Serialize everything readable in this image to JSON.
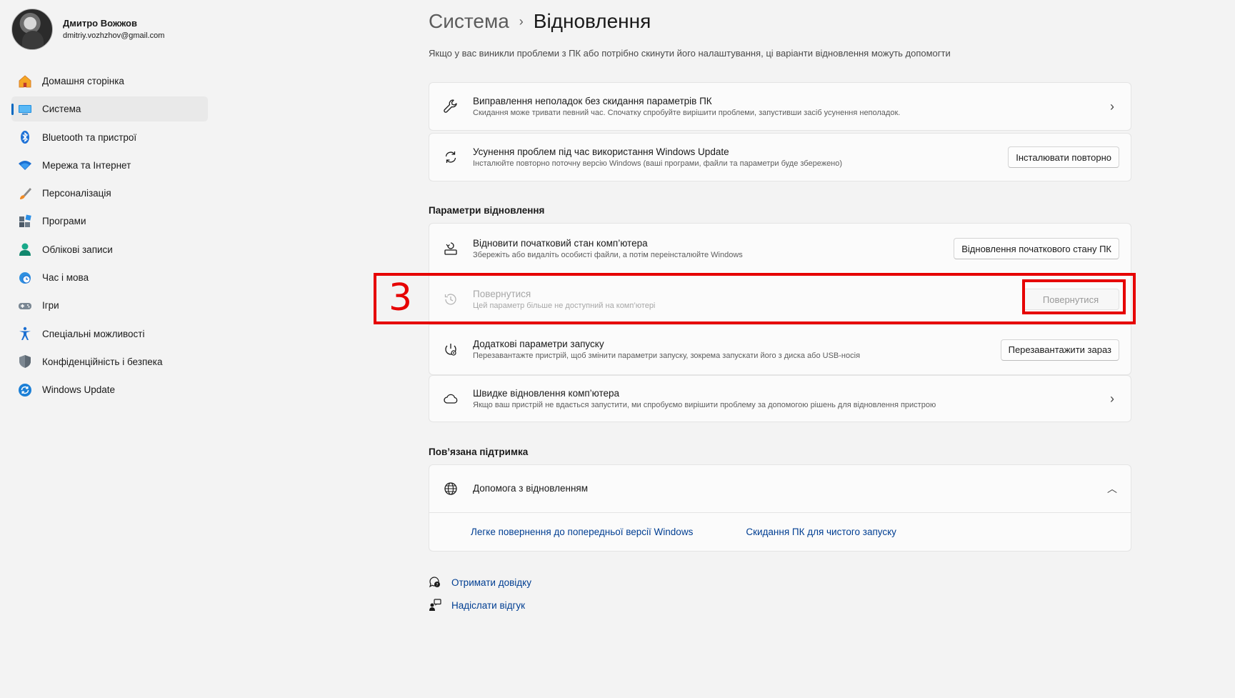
{
  "profile": {
    "name": "Дмитро Вожжов",
    "email": "dmitriy.vozhzhov@gmail.com"
  },
  "sidebar": {
    "items": [
      {
        "label": "Домашня сторінка",
        "icon": "home-icon",
        "active": false
      },
      {
        "label": "Система",
        "icon": "system-icon",
        "active": true
      },
      {
        "label": "Bluetooth та пристрої",
        "icon": "bluetooth-icon",
        "active": false
      },
      {
        "label": "Мережа та Інтернет",
        "icon": "wifi-icon",
        "active": false
      },
      {
        "label": "Персоналізація",
        "icon": "brush-icon",
        "active": false
      },
      {
        "label": "Програми",
        "icon": "apps-icon",
        "active": false
      },
      {
        "label": "Облікові записи",
        "icon": "accounts-icon",
        "active": false
      },
      {
        "label": "Час і мова",
        "icon": "time-language-icon",
        "active": false
      },
      {
        "label": "Ігри",
        "icon": "gamepad-icon",
        "active": false
      },
      {
        "label": "Спеціальні можливості",
        "icon": "accessibility-icon",
        "active": false
      },
      {
        "label": "Конфіденційність і безпека",
        "icon": "shield-icon",
        "active": false
      },
      {
        "label": "Windows Update",
        "icon": "windows-update-icon",
        "active": false
      }
    ]
  },
  "header": {
    "parent": "Система",
    "separator": "›",
    "current": "Відновлення",
    "subtitle": "Якщо у вас виникли проблеми з ПК або потрібно скинути його налаштування, ці варіанти відновлення можуть допомогти"
  },
  "troubleshoot": {
    "title": "Виправлення неполадок без скидання параметрів ПК",
    "desc": "Скидання може тривати певний час. Спочатку спробуйте вирішити проблеми, запустивши засіб усунення неполадок."
  },
  "windows_update_fix": {
    "title": "Усунення проблем під час використання Windows Update",
    "desc": "Інсталюйте повторно поточну версію Windows (ваші програми, файли та параметри буде збережено)",
    "button": "Інсталювати повторно"
  },
  "recovery_options": {
    "section_title": "Параметри відновлення",
    "reset": {
      "title": "Відновити початковий стан комп’ютера",
      "desc": "Збережіть або видаліть особисті файли, а потім переінсталюйте Windows",
      "button": "Відновлення початкового стану ПК"
    },
    "go_back": {
      "title": "Повернутися",
      "desc": "Цей параметр більше не доступний на комп’ютері",
      "button": "Повернутися",
      "enabled": false
    },
    "advanced_startup": {
      "title": "Додаткові параметри запуску",
      "desc": "Перезавантажте пристрій, щоб змінити параметри запуску, зокрема запускати його з диска або USB-носія",
      "button": "Перезавантажити зараз"
    },
    "quick_recovery": {
      "title": "Швидке відновлення комп’ютера",
      "desc": "Якщо ваш пристрій не вдається запустити, ми спробуємо вирішити проблему за допомогою рішень для відновлення пристрою"
    }
  },
  "related_support": {
    "section_title": "Пов’язана підтримка",
    "help_title": "Допомога з відновленням",
    "links": [
      "Легке повернення до попередньої версії Windows",
      "Скидання ПК для чистого запуску"
    ]
  },
  "footer": {
    "get_help": "Отримати довідку",
    "feedback": "Надіслати відгук"
  },
  "annotation": {
    "step": "3",
    "color": "#e60000"
  },
  "colors": {
    "accent": "#0067c0",
    "link": "#003e92",
    "background": "#f3f3f3"
  }
}
